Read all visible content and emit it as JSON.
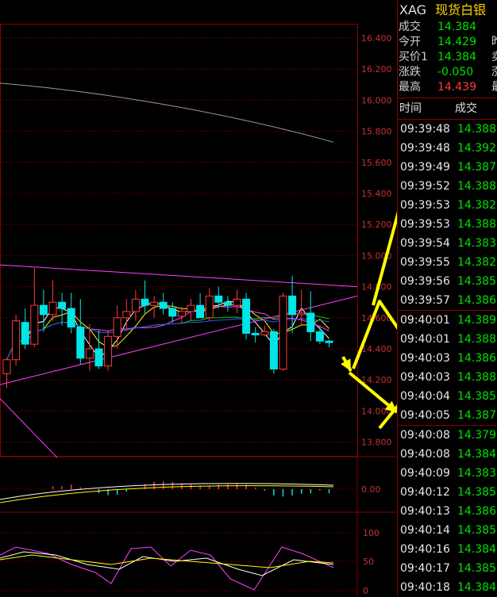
{
  "instrument": {
    "symbol": "XAG",
    "name": "现货白银"
  },
  "colors": {
    "up": "#ff3b3b",
    "down": "#00e000",
    "candle_down": "#00e5e5",
    "grid": "#8a0000",
    "axis_text": "#c83030",
    "arrow": "#ffff00"
  },
  "quote": [
    {
      "label": "成交",
      "value": "14.384",
      "tone": "green",
      "side": ""
    },
    {
      "label": "今开",
      "value": "14.429",
      "tone": "green",
      "side": "昨"
    },
    {
      "label": "买价1",
      "value": "14.384",
      "tone": "green",
      "side": "卖"
    },
    {
      "label": "涨跌",
      "value": "-0.050",
      "tone": "green",
      "side": "涨"
    },
    {
      "label": "最高",
      "value": "14.439",
      "tone": "red",
      "side": "最"
    }
  ],
  "ticks_header": {
    "time": "时间",
    "price": "成交"
  },
  "ticks": [
    {
      "time": "09:39:48",
      "price": "14.388"
    },
    {
      "time": "09:39:48",
      "price": "14.392"
    },
    {
      "time": "09:39:49",
      "price": "14.387"
    },
    {
      "time": "09:39:52",
      "price": "14.388"
    },
    {
      "time": "09:39:53",
      "price": "14.382"
    },
    {
      "time": "09:39:53",
      "price": "14.388"
    },
    {
      "time": "09:39:54",
      "price": "14.383"
    },
    {
      "time": "09:39:55",
      "price": "14.382"
    },
    {
      "time": "09:39:56",
      "price": "14.385"
    },
    {
      "time": "09:39:57",
      "price": "14.386"
    },
    {
      "time": "09:40:01",
      "price": "14.389"
    },
    {
      "time": "09:40:01",
      "price": "14.388"
    },
    {
      "time": "09:40:03",
      "price": "14.386"
    },
    {
      "time": "09:40:03",
      "price": "14.388"
    },
    {
      "time": "09:40:04",
      "price": "14.385"
    },
    {
      "time": "09:40:05",
      "price": "14.387"
    },
    {
      "time": "09:40:08",
      "price": "14.379"
    },
    {
      "time": "09:40:08",
      "price": "14.384"
    },
    {
      "time": "09:40:09",
      "price": "14.383"
    },
    {
      "time": "09:40:12",
      "price": "14.385"
    },
    {
      "time": "09:40:13",
      "price": "14.386"
    },
    {
      "time": "09:40:14",
      "price": "14.385"
    },
    {
      "time": "09:40:16",
      "price": "14.384"
    },
    {
      "time": "09:40:17",
      "price": "14.385"
    },
    {
      "time": "09:40:18",
      "price": "14.384"
    }
  ],
  "price_axis": [
    "16.400",
    "16.200",
    "16.000",
    "15.800",
    "15.600",
    "15.400",
    "15.200",
    "15.000",
    "14.800",
    "14.600",
    "14.400",
    "14.200",
    "14.000",
    "13.800"
  ],
  "price_range": [
    13.75,
    16.55
  ],
  "macd_axis": [
    "0.00"
  ],
  "kdj_axis": [
    "100",
    "50",
    "0"
  ],
  "candles": [
    {
      "o": 14.24,
      "h": 14.34,
      "l": 14.15,
      "c": 14.33
    },
    {
      "o": 14.33,
      "h": 14.62,
      "l": 14.29,
      "c": 14.58
    },
    {
      "o": 14.57,
      "h": 14.66,
      "l": 14.4,
      "c": 14.43
    },
    {
      "o": 14.43,
      "h": 14.92,
      "l": 14.41,
      "c": 14.68
    },
    {
      "o": 14.68,
      "h": 14.78,
      "l": 14.51,
      "c": 14.62
    },
    {
      "o": 14.62,
      "h": 14.84,
      "l": 14.58,
      "c": 14.7
    },
    {
      "o": 14.7,
      "h": 14.76,
      "l": 14.55,
      "c": 14.66
    },
    {
      "o": 14.66,
      "h": 14.76,
      "l": 14.5,
      "c": 14.54
    },
    {
      "o": 14.54,
      "h": 14.72,
      "l": 14.3,
      "c": 14.34
    },
    {
      "o": 14.34,
      "h": 14.56,
      "l": 14.26,
      "c": 14.4
    },
    {
      "o": 14.4,
      "h": 14.52,
      "l": 14.27,
      "c": 14.29
    },
    {
      "o": 14.29,
      "h": 14.52,
      "l": 14.26,
      "c": 14.48
    },
    {
      "o": 14.48,
      "h": 14.68,
      "l": 14.4,
      "c": 14.6
    },
    {
      "o": 14.6,
      "h": 14.72,
      "l": 14.52,
      "c": 14.64
    },
    {
      "o": 14.64,
      "h": 14.78,
      "l": 14.58,
      "c": 14.72
    },
    {
      "o": 14.72,
      "h": 14.84,
      "l": 14.63,
      "c": 14.68
    },
    {
      "o": 14.68,
      "h": 14.74,
      "l": 14.6,
      "c": 14.7
    },
    {
      "o": 14.7,
      "h": 14.76,
      "l": 14.62,
      "c": 14.66
    },
    {
      "o": 14.66,
      "h": 14.7,
      "l": 14.57,
      "c": 14.61
    },
    {
      "o": 14.61,
      "h": 14.67,
      "l": 14.56,
      "c": 14.64
    },
    {
      "o": 14.64,
      "h": 14.72,
      "l": 14.58,
      "c": 14.68
    },
    {
      "o": 14.68,
      "h": 14.76,
      "l": 14.62,
      "c": 14.6
    },
    {
      "o": 14.6,
      "h": 14.79,
      "l": 14.58,
      "c": 14.74
    },
    {
      "o": 14.74,
      "h": 14.8,
      "l": 14.66,
      "c": 14.7
    },
    {
      "o": 14.7,
      "h": 14.74,
      "l": 14.64,
      "c": 14.68
    },
    {
      "o": 14.68,
      "h": 14.78,
      "l": 14.63,
      "c": 14.72
    },
    {
      "o": 14.72,
      "h": 14.76,
      "l": 14.46,
      "c": 14.5
    },
    {
      "o": 14.5,
      "h": 14.54,
      "l": 14.44,
      "c": 14.49
    },
    {
      "o": 14.49,
      "h": 14.55,
      "l": 14.48,
      "c": 14.51
    },
    {
      "o": 14.51,
      "h": 14.53,
      "l": 14.24,
      "c": 14.27
    },
    {
      "o": 14.27,
      "h": 14.76,
      "l": 14.26,
      "c": 14.74
    },
    {
      "o": 14.74,
      "h": 14.87,
      "l": 14.5,
      "c": 14.62
    },
    {
      "o": 14.62,
      "h": 14.78,
      "l": 14.56,
      "c": 14.63
    },
    {
      "o": 14.63,
      "h": 14.77,
      "l": 14.45,
      "c": 14.51
    },
    {
      "o": 14.51,
      "h": 14.55,
      "l": 14.43,
      "c": 14.45
    },
    {
      "o": 14.45,
      "h": 14.46,
      "l": 14.41,
      "c": 14.44
    }
  ]
}
